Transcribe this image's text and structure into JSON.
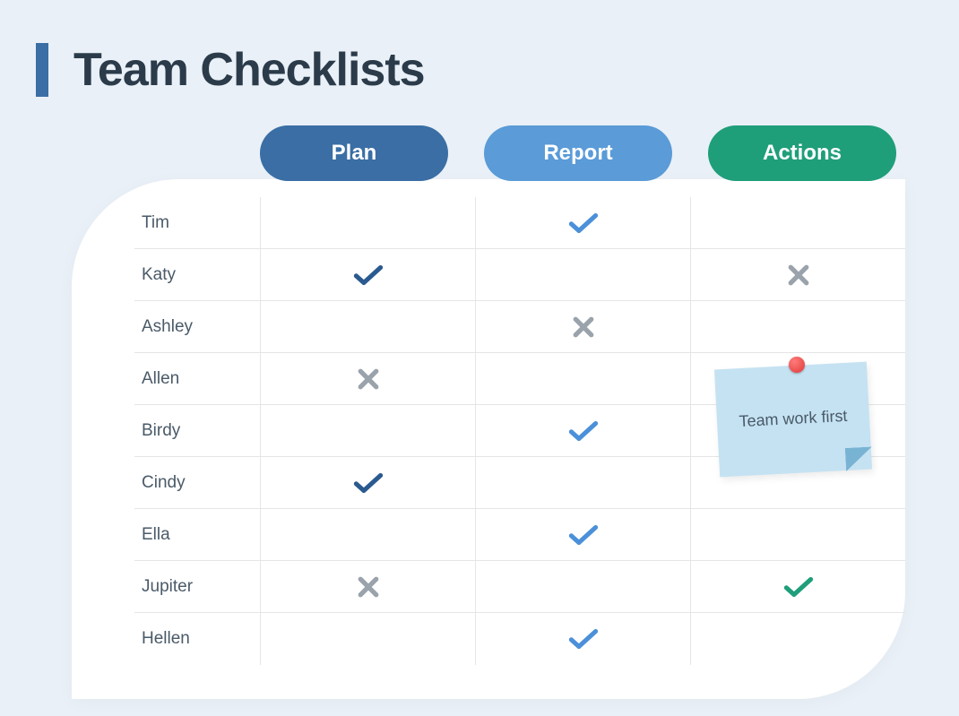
{
  "title": "Team Checklists",
  "columns": [
    {
      "label": "Plan",
      "color": "#3a6ea5"
    },
    {
      "label": "Report",
      "color": "#5a9bd8"
    },
    {
      "label": "Actions",
      "color": "#1f9e7a"
    }
  ],
  "icon_colors": {
    "check_dark": "#2a5a8f",
    "check_light": "#4b90d9",
    "check_green": "#1f9e7a",
    "cross": "#9aa3ab"
  },
  "rows": [
    {
      "name": "Tim",
      "cells": [
        "",
        "check_light",
        ""
      ]
    },
    {
      "name": "Katy",
      "cells": [
        "check_dark",
        "",
        "cross"
      ]
    },
    {
      "name": "Ashley",
      "cells": [
        "",
        "cross",
        ""
      ]
    },
    {
      "name": "Allen",
      "cells": [
        "cross",
        "",
        ""
      ]
    },
    {
      "name": "Birdy",
      "cells": [
        "",
        "check_light",
        ""
      ]
    },
    {
      "name": "Cindy",
      "cells": [
        "check_dark",
        "",
        ""
      ]
    },
    {
      "name": "Ella",
      "cells": [
        "",
        "check_light",
        ""
      ]
    },
    {
      "name": "Jupiter",
      "cells": [
        "cross",
        "",
        "check_green"
      ]
    },
    {
      "name": "Hellen",
      "cells": [
        "",
        "check_light",
        ""
      ]
    }
  ],
  "sticky_note": "Team work first"
}
